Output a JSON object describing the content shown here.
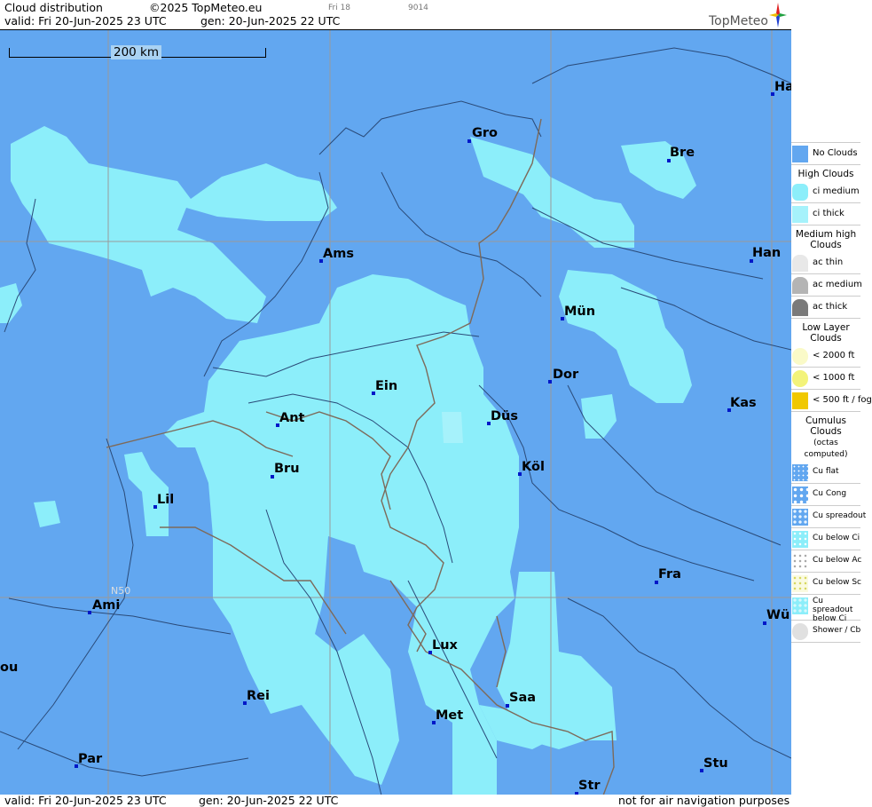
{
  "header": {
    "title": "Cloud distribution",
    "copyright": "©2025 TopMeteo.eu",
    "valid": "valid:  Fri  20-Jun-2025  23 UTC",
    "gen": "gen: 20-Jun-2025 22 UTC",
    "small1": "Fri 18",
    "small2": "9014",
    "logo_text": "TopMeteo"
  },
  "map": {
    "scale_label": "200 km",
    "lat_label": "N50",
    "cities": [
      {
        "label": "Gro"
      },
      {
        "label": "Bre"
      },
      {
        "label": "Ha"
      },
      {
        "label": "Ams"
      },
      {
        "label": "Han"
      },
      {
        "label": "Mün"
      },
      {
        "label": "Dor"
      },
      {
        "label": "Ein"
      },
      {
        "label": "Ant"
      },
      {
        "label": "Düs"
      },
      {
        "label": "Kas"
      },
      {
        "label": "Bru"
      },
      {
        "label": "Köl"
      },
      {
        "label": "Lil"
      },
      {
        "label": "Fra"
      },
      {
        "label": "Ami"
      },
      {
        "label": "Lux"
      },
      {
        "label": "Wü"
      },
      {
        "label": "ou"
      },
      {
        "label": "Rei"
      },
      {
        "label": "Saa"
      },
      {
        "label": "Met"
      },
      {
        "label": "Par"
      },
      {
        "label": "Stu"
      },
      {
        "label": "Str"
      }
    ]
  },
  "footer": {
    "valid": "valid:  Fri  20-Jun-2025  23 UTC",
    "gen": "gen: 20-Jun-2025 22 UTC",
    "note": "not for air navigation purposes"
  },
  "legend": {
    "no_clouds": "No Clouds",
    "high_head": "High Clouds",
    "ci_medium": "ci medium",
    "ci_thick": "ci thick",
    "medium_head": "Medium high Clouds",
    "ac_thin": "ac thin",
    "ac_medium": "ac medium",
    "ac_thick": "ac thick",
    "low_head": "Low Layer Clouds",
    "low1": "< 2000 ft",
    "low2": "< 1000 ft",
    "low3": "< 500 ft / fog",
    "cu_head": "Cumulus Clouds",
    "cu_sub": "(octas computed)",
    "cu_flat": "Cu flat",
    "cu_cong": "Cu Cong",
    "cu_spread": "Cu spreadout",
    "cu_below_ci": "Cu below Ci",
    "cu_below_ac": "Cu below Ac",
    "cu_below_sc": "Cu below Sc",
    "cu_spread_ci": "Cu spreadout below Ci",
    "shower": "Shower / Cb"
  },
  "colors": {
    "no_clouds": "#62a7f0",
    "ci_medium": "#8ceefa",
    "ci_thick": "#a6f2fb",
    "city_dot": "#0018c8"
  }
}
